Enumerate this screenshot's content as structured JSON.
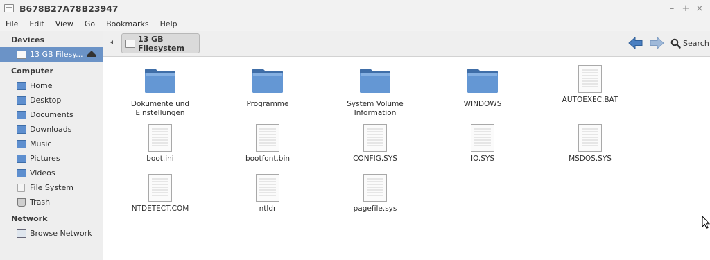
{
  "window": {
    "title": "B678B27A78B23947",
    "controls": [
      "–",
      "+",
      "×"
    ]
  },
  "menu": [
    "File",
    "Edit",
    "View",
    "Go",
    "Bookmarks",
    "Help"
  ],
  "sidebar": {
    "devices_header": "Devices",
    "devices": [
      {
        "label": "13 GB Filesy...",
        "icon": "drive-icon",
        "selected": true
      }
    ],
    "computer_header": "Computer",
    "computer": [
      {
        "label": "Home",
        "icon": "home-icon"
      },
      {
        "label": "Desktop",
        "icon": "desktop-icon"
      },
      {
        "label": "Documents",
        "icon": "documents-icon"
      },
      {
        "label": "Downloads",
        "icon": "downloads-icon"
      },
      {
        "label": "Music",
        "icon": "music-icon"
      },
      {
        "label": "Pictures",
        "icon": "pictures-icon"
      },
      {
        "label": "Videos",
        "icon": "videos-icon"
      },
      {
        "label": "File System",
        "icon": "filesystem-icon"
      },
      {
        "label": "Trash",
        "icon": "trash-icon"
      }
    ],
    "network_header": "Network",
    "network": [
      {
        "label": "Browse Network",
        "icon": "network-icon"
      }
    ]
  },
  "toolbar": {
    "path_label": "13 GB Filesystem",
    "search_label": "Search"
  },
  "files": [
    {
      "name": "Dokumente und Einstellungen",
      "type": "folder"
    },
    {
      "name": "Programme",
      "type": "folder"
    },
    {
      "name": "System Volume Information",
      "type": "folder"
    },
    {
      "name": "WINDOWS",
      "type": "folder"
    },
    {
      "name": "AUTOEXEC.BAT",
      "type": "file"
    },
    {
      "name": "boot.ini",
      "type": "file"
    },
    {
      "name": "bootfont.bin",
      "type": "file"
    },
    {
      "name": "CONFIG.SYS",
      "type": "file"
    },
    {
      "name": "IO.SYS",
      "type": "file"
    },
    {
      "name": "MSDOS.SYS",
      "type": "file"
    },
    {
      "name": "NTDETECT.COM",
      "type": "file"
    },
    {
      "name": "ntldr",
      "type": "file"
    },
    {
      "name": "pagefile.sys",
      "type": "file"
    }
  ],
  "colors": {
    "selection": "#6b93c7",
    "folder": "#5e8fcf",
    "nav_arrow": "#4a7fc1"
  }
}
